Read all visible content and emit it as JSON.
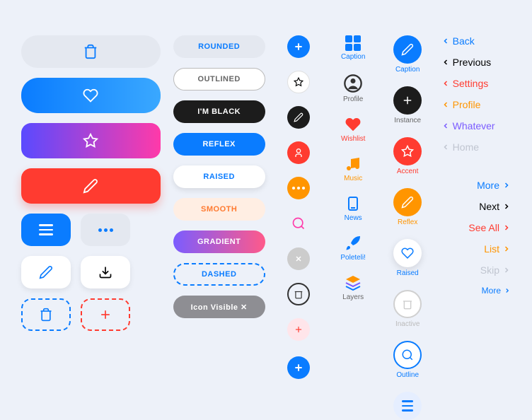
{
  "pills": {
    "rounded": "ROUNDED",
    "outlined": "OUTLINED",
    "black": "I'M BLACK",
    "reflex": "REFLEX",
    "raised": "RAISED",
    "smooth": "SMOOTH",
    "gradient": "GRADIENT",
    "dashed": "DASHED",
    "icon_visible": "Icon Visible ✕"
  },
  "captions": {
    "caption": "Caption",
    "profile": "Profile",
    "instance": "Instance",
    "wishlist": "Wishlist",
    "accent": "Accent",
    "music": "Music",
    "reflex": "Reflex",
    "news": "News",
    "raised": "Raised",
    "inactive": "Inactive",
    "poleteli": "Poleteli!",
    "outline": "Outline",
    "layers": "Layers"
  },
  "links": {
    "back": "Back",
    "previous": "Previous",
    "settings": "Settings",
    "profile": "Profile",
    "whatever": "Whatever",
    "home": "Home",
    "more": "More",
    "next": "Next",
    "see_all": "See All",
    "list": "List",
    "skip": "Skip",
    "more2": "More"
  }
}
